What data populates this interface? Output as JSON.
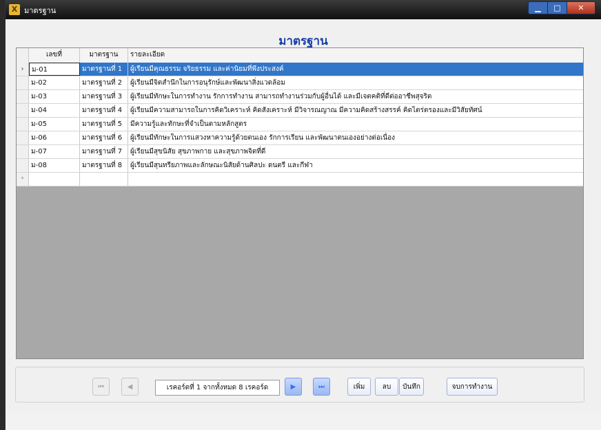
{
  "window": {
    "title": "มาตรฐาน",
    "icon": "app-icon",
    "controls": [
      "minimize-icon",
      "maximize-icon",
      "close-icon"
    ]
  },
  "heading": "มาตรฐาน",
  "grid": {
    "columns": [
      "เลขที่",
      "มาตรฐาน",
      "รายละเอียด"
    ],
    "rows": [
      {
        "id": "ม-01",
        "std": "มาตรฐานที่ 1",
        "detail": "ผู้เรียนมีคุณธรรม จริยธรรม และค่านิยมที่พึงประสงค์"
      },
      {
        "id": "ม-02",
        "std": "มาตรฐานที่ 2",
        "detail": "ผู้เรียนมีจิตสำนึกในการอนุรักษ์และพัฒนาสิ่งแวดล้อม"
      },
      {
        "id": "ม-03",
        "std": "มาตรฐานที่ 3",
        "detail": "ผู้เรียนมีทักษะในการทำงาน รักการทำงาน สามารถทำงานร่วมกับผู้อื่นได้ และมีเจตคติที่ดีต่ออาชีพสุจริต"
      },
      {
        "id": "ม-04",
        "std": "มาตรฐานที่ 4",
        "detail": "ผู้เรียนมีความสามารถในการคิดวิเคราะห์ คิดสังเคราะห์ มีวิจารณญาณ มีความคิดสร้างสรรค์ คิดไตร่ตรองและมีวิสัยทัศน์"
      },
      {
        "id": "ม-05",
        "std": "มาตรฐานที่ 5",
        "detail": "มีความรู้และทักษะที่จำเป็นตามหลักสูตร"
      },
      {
        "id": "ม-06",
        "std": "มาตรฐานที่ 6",
        "detail": "ผู้เรียนมีทักษะในการแสวงหาความรู้ด้วยตนเอง รักการเรียน และพัฒนาตนเองอย่างต่อเนื่อง"
      },
      {
        "id": "ม-07",
        "std": "มาตรฐานที่ 7",
        "detail": "ผู้เรียนมีสุขนิสัย สุขภาพกาย และสุขภาพจิตที่ดี"
      },
      {
        "id": "ม-08",
        "std": "มาตรฐานที่ 8",
        "detail": "ผู้เรียนมีสุนทรียภาพและลักษณะนิสัยด้านศิลปะ ดนตรี และกีฬา"
      }
    ],
    "current_marker": "›",
    "new_marker": "*"
  },
  "navigator": {
    "record_info": "เรคอร์ดที่ 1 จากทั้งหมด 8 เรคอร์ด",
    "first_icon": "⏮",
    "prev_icon": "◀",
    "next_icon": "▶",
    "last_icon": "⏭",
    "add_label": "เพิ่ม",
    "delete_label": "ลบ",
    "save_label": "บันทึก",
    "exit_label": "จบการทำงาน"
  },
  "colors": {
    "selected_row": "#3176c8",
    "heading": "#1a3fa8",
    "titlebar": "#1a1a1a"
  }
}
